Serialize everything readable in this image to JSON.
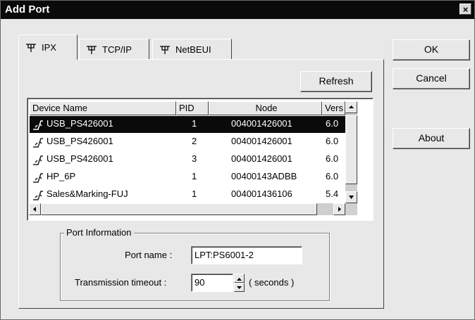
{
  "window": {
    "title": "Add Port",
    "close_label": "×"
  },
  "tabs": [
    {
      "label": "IPX",
      "icon": "network-icon",
      "active": true
    },
    {
      "label": "TCP/IP",
      "icon": "network-icon",
      "active": false
    },
    {
      "label": "NetBEUI",
      "icon": "network-icon",
      "active": false
    }
  ],
  "buttons": {
    "refresh": "Refresh",
    "ok": "OK",
    "cancel": "Cancel",
    "about": "About"
  },
  "device_list": {
    "columns": [
      "Device Name",
      "PID",
      "Node",
      "Vers"
    ],
    "rows": [
      {
        "name": "USB_PS426001",
        "pid": "1",
        "node": "004001426001",
        "vers": "6.0",
        "selected": true
      },
      {
        "name": "USB_PS426001",
        "pid": "2",
        "node": "004001426001",
        "vers": "6.0",
        "selected": false
      },
      {
        "name": "USB_PS426001",
        "pid": "3",
        "node": "004001426001",
        "vers": "6.0",
        "selected": false
      },
      {
        "name": "HP_6P",
        "pid": "1",
        "node": "00400143ADBB",
        "vers": "6.0",
        "selected": false
      },
      {
        "name": "Sales&Marking-FUJ",
        "pid": "1",
        "node": "004001436106",
        "vers": "5.4",
        "selected": false
      }
    ]
  },
  "port_info": {
    "group_label": "Port Information",
    "port_name_label": "Port name :",
    "port_name_value": "LPT:PS6001-2",
    "timeout_label": "Transmission timeout :",
    "timeout_value": "90",
    "timeout_unit": "( seconds )"
  },
  "colors": {
    "title_bar": "#0a0a0a",
    "selection": "#0a0a0a",
    "face": "#e8e8e8"
  }
}
